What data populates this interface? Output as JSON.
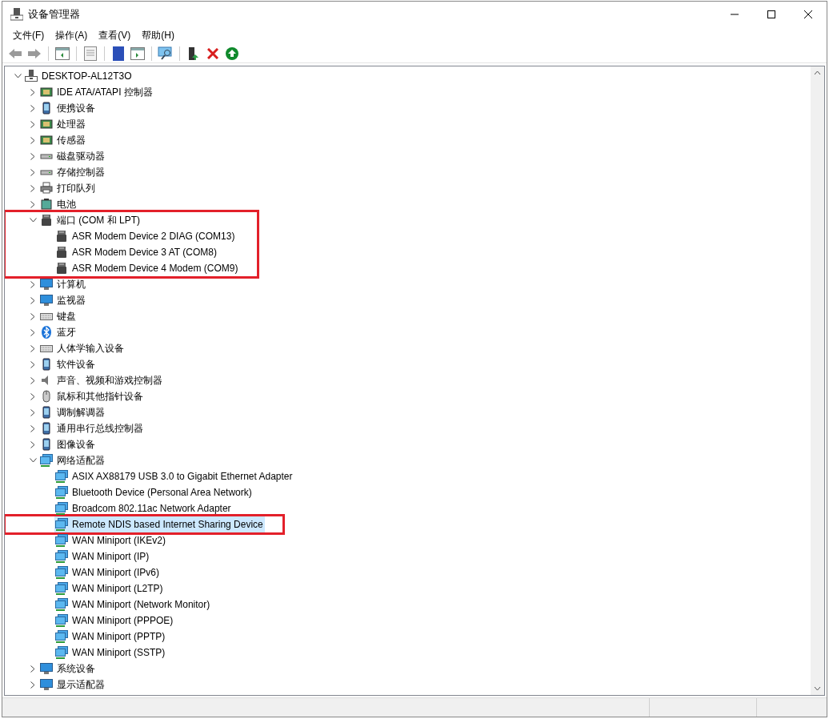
{
  "window": {
    "title": "设备管理器"
  },
  "menu": [
    "文件(F)",
    "操作(A)",
    "查看(V)",
    "帮助(H)"
  ],
  "tree": {
    "label": "DESKTOP-AL12T3O",
    "kind": "computer",
    "expanded": true,
    "selected": false,
    "children": [
      {
        "label": "IDE ATA/ATAPI 控制器",
        "kind": "chip",
        "expanded": false,
        "selected": false
      },
      {
        "label": "便携设备",
        "kind": "device",
        "expanded": false,
        "selected": false
      },
      {
        "label": "处理器",
        "kind": "chip",
        "expanded": false,
        "selected": false
      },
      {
        "label": "传感器",
        "kind": "chip",
        "expanded": false,
        "selected": false
      },
      {
        "label": "磁盘驱动器",
        "kind": "disk",
        "expanded": false,
        "selected": false
      },
      {
        "label": "存储控制器",
        "kind": "disk",
        "expanded": false,
        "selected": false
      },
      {
        "label": "打印队列",
        "kind": "printer",
        "expanded": false,
        "selected": false
      },
      {
        "label": "电池",
        "kind": "battery",
        "expanded": false,
        "selected": false
      },
      {
        "label": "端口 (COM 和 LPT)",
        "kind": "port",
        "expanded": true,
        "selected": false,
        "outlined": true,
        "children": [
          {
            "label": "ASR Modem Device 2 DIAG (COM13)",
            "kind": "port",
            "selected": false
          },
          {
            "label": "ASR Modem Device 3 AT (COM8)",
            "kind": "port",
            "selected": false
          },
          {
            "label": "ASR Modem Device 4 Modem (COM9)",
            "kind": "port",
            "selected": false
          }
        ]
      },
      {
        "label": "计算机",
        "kind": "monitor",
        "expanded": false,
        "selected": false
      },
      {
        "label": "监视器",
        "kind": "monitor",
        "expanded": false,
        "selected": false
      },
      {
        "label": "键盘",
        "kind": "keyboard",
        "expanded": false,
        "selected": false
      },
      {
        "label": "蓝牙",
        "kind": "bluetooth",
        "expanded": false,
        "selected": false
      },
      {
        "label": "人体学输入设备",
        "kind": "keyboard",
        "expanded": false,
        "selected": false
      },
      {
        "label": "软件设备",
        "kind": "device",
        "expanded": false,
        "selected": false
      },
      {
        "label": "声音、视频和游戏控制器",
        "kind": "speaker",
        "expanded": false,
        "selected": false
      },
      {
        "label": "鼠标和其他指针设备",
        "kind": "mouse",
        "expanded": false,
        "selected": false
      },
      {
        "label": "调制解调器",
        "kind": "device",
        "expanded": false,
        "selected": false
      },
      {
        "label": "通用串行总线控制器",
        "kind": "device",
        "expanded": false,
        "selected": false
      },
      {
        "label": "图像设备",
        "kind": "device",
        "expanded": false,
        "selected": false
      },
      {
        "label": "网络适配器",
        "kind": "network",
        "expanded": true,
        "selected": false,
        "children": [
          {
            "label": "ASIX AX88179 USB 3.0 to Gigabit Ethernet Adapter",
            "kind": "network",
            "selected": false
          },
          {
            "label": "Bluetooth Device (Personal Area Network)",
            "kind": "network",
            "selected": false
          },
          {
            "label": "Broadcom 802.11ac Network Adapter",
            "kind": "network",
            "selected": false
          },
          {
            "label": "Remote NDIS based Internet Sharing Device",
            "kind": "network",
            "selected": true,
            "outlined": true
          },
          {
            "label": "WAN Miniport (IKEv2)",
            "kind": "network",
            "selected": false
          },
          {
            "label": "WAN Miniport (IP)",
            "kind": "network",
            "selected": false
          },
          {
            "label": "WAN Miniport (IPv6)",
            "kind": "network",
            "selected": false
          },
          {
            "label": "WAN Miniport (L2TP)",
            "kind": "network",
            "selected": false
          },
          {
            "label": "WAN Miniport (Network Monitor)",
            "kind": "network",
            "selected": false
          },
          {
            "label": "WAN Miniport (PPPOE)",
            "kind": "network",
            "selected": false
          },
          {
            "label": "WAN Miniport (PPTP)",
            "kind": "network",
            "selected": false
          },
          {
            "label": "WAN Miniport (SSTP)",
            "kind": "network",
            "selected": false
          }
        ]
      },
      {
        "label": "系统设备",
        "kind": "monitor",
        "expanded": false,
        "selected": false
      },
      {
        "label": "显示适配器",
        "kind": "monitor",
        "expanded": false,
        "selected": false
      }
    ]
  }
}
